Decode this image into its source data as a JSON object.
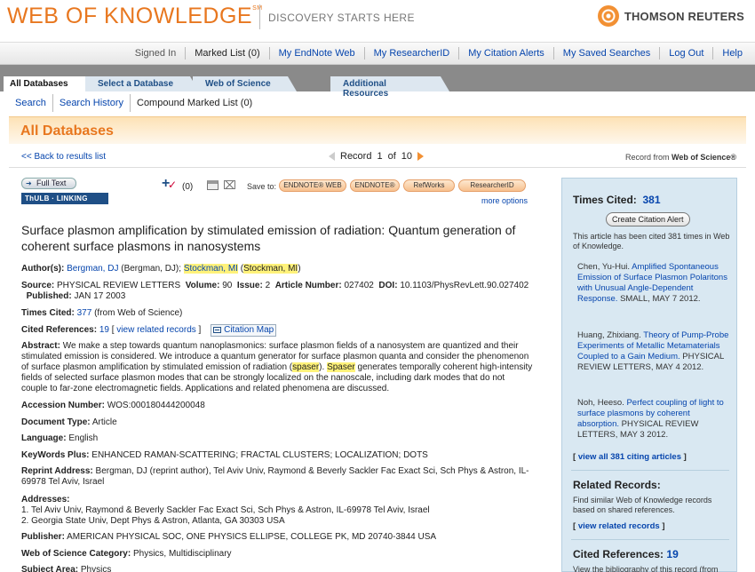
{
  "header": {
    "logo": "WEB OF KNOWLEDGE",
    "logo_sup": "SM",
    "tagline": "DISCOVERY STARTS HERE",
    "brand": "THOMSON REUTERS"
  },
  "topnav": [
    "Signed In",
    "Marked List (0)",
    "My EndNote Web",
    "My ResearcherID",
    "My Citation Alerts",
    "My Saved Searches",
    "Log Out",
    "Help"
  ],
  "tabs": [
    "All Databases",
    "Select a Database",
    "Web of Science",
    "Additional Resources"
  ],
  "subnav": [
    "Search",
    "Search History",
    "Compound Marked List (0)"
  ],
  "band_title": "All Databases",
  "record_nav": {
    "back": "<< Back to results list",
    "record_label": "Record",
    "current": "1",
    "of": "of",
    "total": "10",
    "from_prefix": "Record from",
    "from_source": "Web of Science®"
  },
  "tools": {
    "full_text": "Full Text",
    "linking": "ThULB · LINKING",
    "marked_count": "(0)",
    "save_to": "Save to:",
    "save_options": [
      "ENDNOTE® WEB",
      "ENDNOTE®",
      "RefWorks",
      "ResearcherID"
    ],
    "more_options": "more options"
  },
  "record": {
    "title": "Surface plasmon amplification by stimulated emission of radiation: Quantum generation of coherent surface plasmons in nanosystems",
    "authors_label": "Author(s):",
    "author1_link": "Bergman, DJ",
    "author1_full": " (Bergman, DJ); ",
    "author2_link": "Stockman, MI",
    "author2_open": " (",
    "author2_full": "Stockman, MI",
    "author2_close": ")",
    "source_label": "Source:",
    "source": "PHYSICAL REVIEW LETTERS",
    "volume_label": "Volume:",
    "volume": "90",
    "issue_label": "Issue:",
    "issue": "2",
    "article_label": "Article Number:",
    "article": "027402",
    "doi_label": "DOI:",
    "doi": "10.1103/PhysRevLett.90.027402",
    "published_label": "Published:",
    "published": "JAN 17 2003",
    "times_cited_label": "Times Cited:",
    "times_cited": "377",
    "times_cited_suffix": " (from Web of Science)",
    "cited_refs_label": "Cited References:",
    "cited_refs": "19",
    "related_open": " [ ",
    "related_link": "view related records",
    "related_close": " ]",
    "citation_map": "Citation Map",
    "abstract_label": "Abstract:",
    "abstract_a": "We make a step towards quantum nanoplasmonics: surface plasmon fields of a nanosystem are quantized and their stimulated emission is considered. We introduce a quantum generator for surface plasmon quanta and consider the phenomenon of surface plasmon amplification by stimulated emission of radiation (",
    "abstract_hl1": "spaser",
    "abstract_b": "). ",
    "abstract_hl2": "Spaser",
    "abstract_c": " generates temporally coherent high-intensity fields of selected surface plasmon modes that can be strongly localized on the nanoscale, including dark modes that do not couple to far-zone electromagnetic fields. Applications and related phenomena are discussed.",
    "accession_label": "Accession Number:",
    "accession": "WOS:000180444200048",
    "doctype_label": "Document Type:",
    "doctype": "Article",
    "language_label": "Language:",
    "language": "English",
    "keywords_label": "KeyWords Plus:",
    "keywords": "ENHANCED RAMAN-SCATTERING; FRACTAL CLUSTERS; LOCALIZATION; DOTS",
    "reprint_label": "Reprint Address:",
    "reprint": "Bergman, DJ (reprint author), Tel Aviv Univ, Raymond & Beverly Sackler Fac Exact Sci, Sch Phys & Astron, IL-69978 Tel Aviv, Israel",
    "addresses_label": "Addresses:",
    "address1": "1. Tel Aviv Univ, Raymond & Beverly Sackler Fac Exact Sci, Sch Phys & Astron, IL-69978 Tel Aviv, Israel",
    "address2": "2. Georgia State Univ, Dept Phys & Astron, Atlanta, GA 30303 USA",
    "publisher_label": "Publisher:",
    "publisher": "AMERICAN PHYSICAL SOC, ONE PHYSICS ELLIPSE, COLLEGE PK, MD 20740-3844 USA",
    "category_label": "Web of Science Category:",
    "category": "Physics, Multidisciplinary",
    "subject_label": "Subject Area:",
    "subject": "Physics"
  },
  "sidebar": {
    "times_cited_label": "Times Cited:",
    "times_cited": "381",
    "alert_button": "Create Citation Alert",
    "cited_note": "This article has been cited 381 times in Web of Knowledge.",
    "citing": [
      {
        "author": "Chen, Yu-Hui.",
        "title": "Amplified Spontaneous Emission of Surface Plasmon Polaritons with Unusual Angle-Dependent Response.",
        "venue": "SMALL, MAY 7 2012."
      },
      {
        "author": "Huang, Zhixiang.",
        "title": "Theory of Pump-Probe Experiments of Metallic Metamaterials Coupled to a Gain Medium.",
        "venue": "PHYSICAL REVIEW LETTERS, MAY 4 2012."
      },
      {
        "author": "Noh, Heeso.",
        "title": "Perfect coupling of light to surface plasmons by coherent absorption.",
        "venue": "PHYSICAL REVIEW LETTERS, MAY 3 2012."
      }
    ],
    "view_all_open": "[ ",
    "view_all": "view all 381 citing articles",
    "view_all_close": " ]",
    "related_heading": "Related Records:",
    "related_note": "Find similar Web of Knowledge records based on shared references.",
    "related_link": "view related records",
    "cited_refs_heading": "Cited References:",
    "cited_refs": "19",
    "cited_refs_note": "View the bibliography of this record (from"
  }
}
